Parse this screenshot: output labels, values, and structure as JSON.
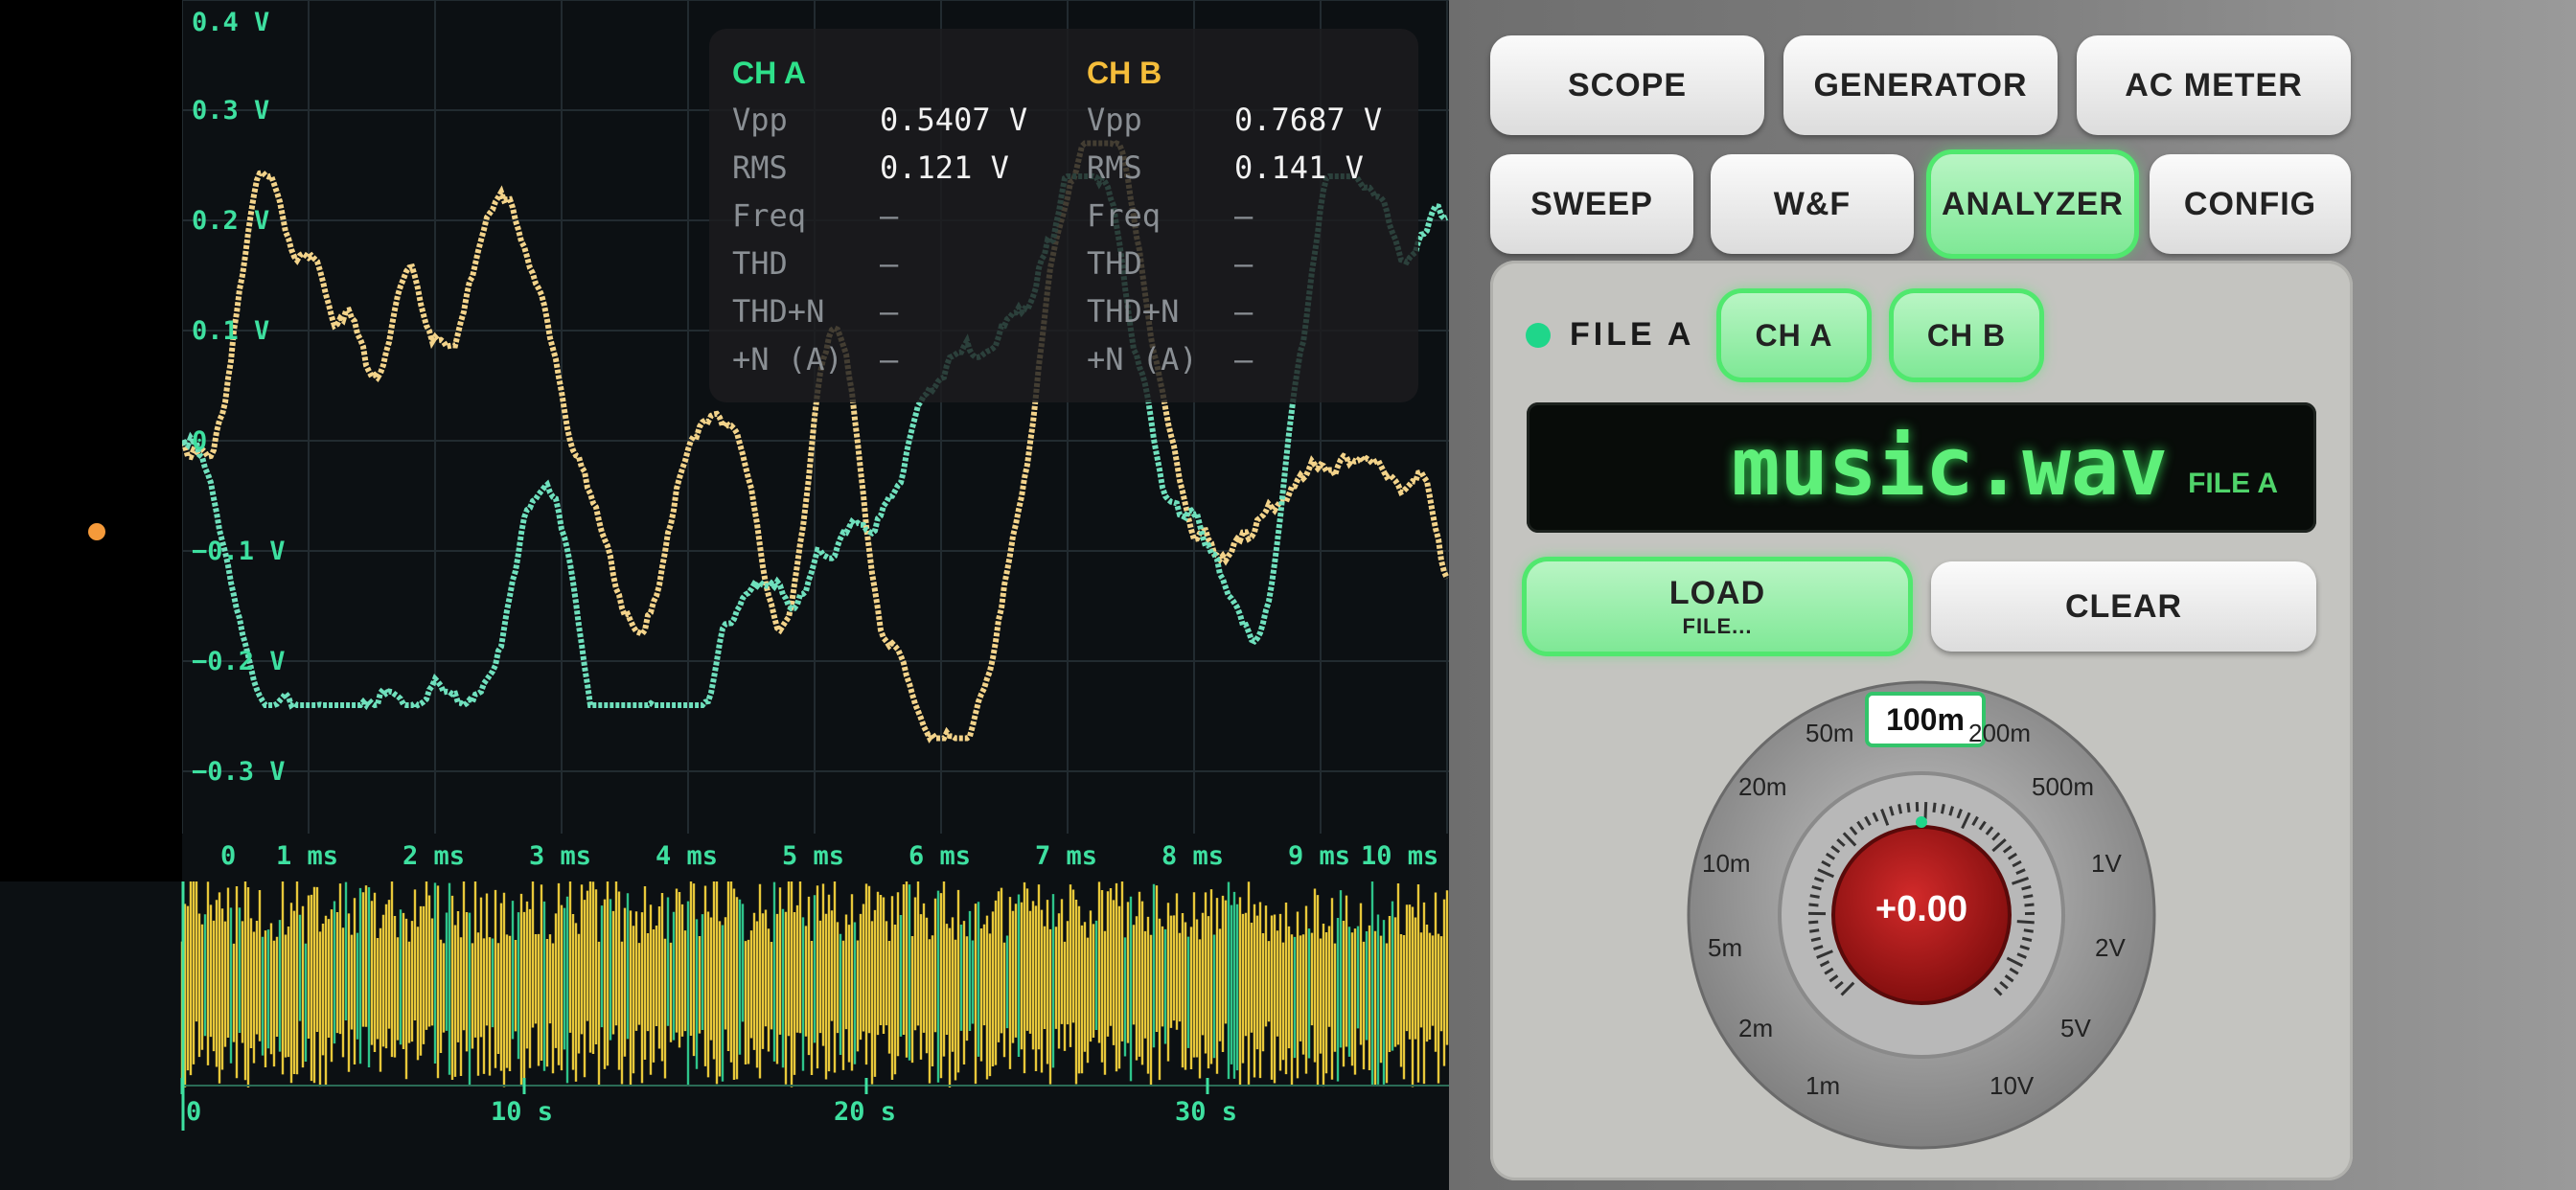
{
  "scope": {
    "y_labels": [
      "0.4 V",
      "0.3 V",
      "0.2 V",
      "0.1 V",
      "0",
      "−0.1 V",
      "−0.2 V",
      "−0.3 V"
    ],
    "x_labels": [
      "0",
      "1 ms",
      "2 ms",
      "3 ms",
      "4 ms",
      "5 ms",
      "6 ms",
      "7 ms",
      "8 ms",
      "9 ms",
      "10 ms"
    ],
    "overview_labels": [
      "0",
      "10 s",
      "20 s",
      "30 s"
    ],
    "colors": {
      "ch_a": "#6fe0bd",
      "ch_b": "#f3d38a",
      "grid": "#222b30",
      "overview": "#e8c83a"
    }
  },
  "measurements": {
    "ch_a": {
      "title": "CH A",
      "color": "#2ee08a",
      "vpp_label": "Vpp",
      "vpp": "0.5407 V",
      "rms_label": "RMS",
      "rms": "0.121 V",
      "freq_label": "Freq",
      "freq": "—",
      "thd_label": "THD",
      "thd": "—",
      "thdn_label": "THD+N",
      "thdn": "—",
      "na_label": "+N (A)",
      "na": "—"
    },
    "ch_b": {
      "title": "CH B",
      "color": "#f5bd3a",
      "vpp_label": "Vpp",
      "vpp": "0.7687 V",
      "rms_label": "RMS",
      "rms": "0.141 V",
      "freq_label": "Freq",
      "freq": "—",
      "thd_label": "THD",
      "thd": "—",
      "thdn_label": "THD+N",
      "thdn": "—",
      "na_label": "+N (A)",
      "na": "—"
    }
  },
  "tabs": {
    "scope": "SCOPE",
    "generator": "GENERATOR",
    "ac_meter": "AC METER",
    "sweep": "SWEEP",
    "wf": "W&F",
    "analyzer": "ANALYZER",
    "config": "CONFIG",
    "active": "ANALYZER"
  },
  "analyzer": {
    "file_label": "FILE A",
    "ch_a_btn": "CH A",
    "ch_b_btn": "CH B",
    "display_name": "music.wav",
    "display_tag": "FILE A",
    "load_label": "LOAD",
    "load_sub": "FILE...",
    "clear_label": "CLEAR",
    "knob": {
      "selected": "100m",
      "value": "+0.00",
      "scale": [
        "50m",
        "200m",
        "20m",
        "500m",
        "10m",
        "1V",
        "5m",
        "2V",
        "2m",
        "5V",
        "1m",
        "10V"
      ]
    }
  }
}
